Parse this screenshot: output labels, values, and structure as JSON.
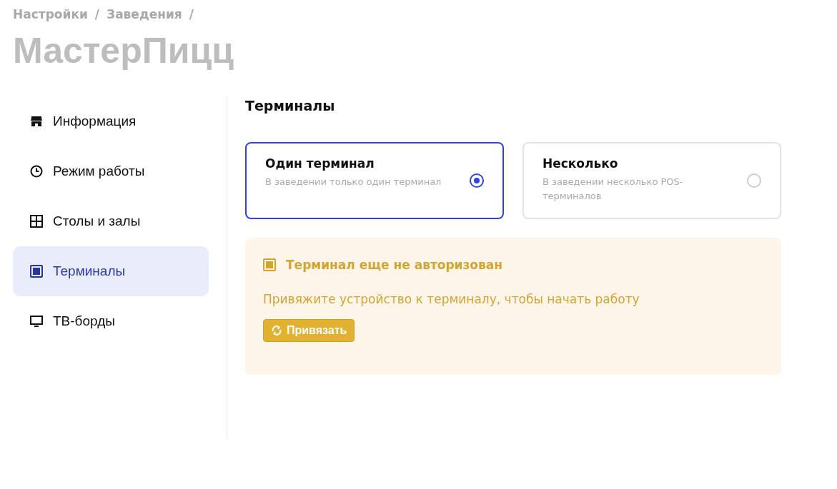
{
  "breadcrumbs": [
    "Настройки",
    "/",
    "Заведения",
    "/"
  ],
  "title": "МастерПицц",
  "sidebar": {
    "items": [
      {
        "label": "Информация",
        "kind": "store",
        "selected": false
      },
      {
        "label": "Режим работы",
        "kind": "clock",
        "selected": false
      },
      {
        "label": "Столы и залы",
        "kind": "grid",
        "selected": false
      },
      {
        "label": "Терминалы",
        "kind": "terminal",
        "selected": true
      },
      {
        "label": "ТВ-борды",
        "kind": "monitor",
        "selected": false
      }
    ]
  },
  "section": {
    "heading": "Терминалы",
    "options": [
      {
        "title": "Один терминал",
        "description": "В заведении только один терминал",
        "selected": true
      },
      {
        "title": "Несколько",
        "description": "В заведении несколько POS-терминалов",
        "selected": false
      }
    ],
    "alert": {
      "title": "Терминал еще не авторизован",
      "message": "Привяжите устройство к терминалу, чтобы начать работу",
      "button": "Привязать"
    }
  }
}
